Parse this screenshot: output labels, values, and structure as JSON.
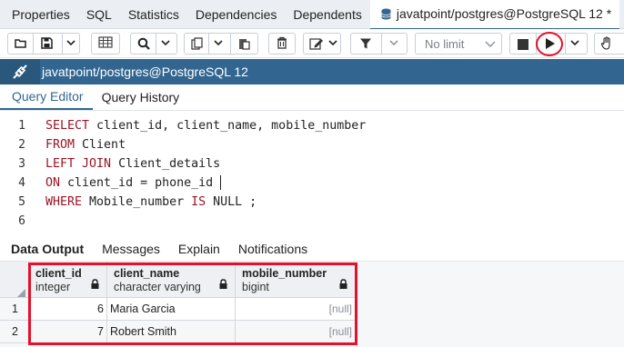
{
  "top_tabs": [
    {
      "label": "Properties"
    },
    {
      "label": "SQL"
    },
    {
      "label": "Statistics"
    },
    {
      "label": "Dependencies"
    },
    {
      "label": "Dependents"
    },
    {
      "label": "javatpoint/postgres@PostgreSQL 12 *",
      "icon": "database-icon",
      "active": true
    }
  ],
  "toolbar": {
    "limit_label": "No limit"
  },
  "connection": {
    "label": "javatpoint/postgres@PostgreSQL 12"
  },
  "editor_tabs": [
    {
      "label": "Query Editor",
      "active": true
    },
    {
      "label": "Query History"
    }
  ],
  "editor": {
    "line_numbers": [
      "1",
      "2",
      "3",
      "4",
      "5",
      "6"
    ],
    "lines": [
      {
        "kw1": "SELECT",
        "rest": " client_id, client_name, mobile_number"
      },
      {
        "kw1": "FROM",
        "rest": " Client"
      },
      {
        "kw1": "LEFT JOIN",
        "rest": " Client_details"
      },
      {
        "kw1": "ON",
        "rest": " client_id = phone_id"
      },
      {
        "kw1": "WHERE",
        "rest": " Mobile_number ",
        "kw2": "IS",
        "rest2": " NULL ;"
      },
      {
        "kw1": "",
        "rest": ""
      }
    ]
  },
  "output_tabs": [
    {
      "label": "Data Output",
      "active": true
    },
    {
      "label": "Messages"
    },
    {
      "label": "Explain"
    },
    {
      "label": "Notifications"
    }
  ],
  "grid": {
    "columns": [
      {
        "name": "client_id",
        "type": "integer"
      },
      {
        "name": "client_name",
        "type": "character varying"
      },
      {
        "name": "mobile_number",
        "type": "bigint"
      }
    ],
    "rows": [
      {
        "num": "1",
        "client_id": "6",
        "client_name": "Maria Garcia",
        "mobile_number": "[null]"
      },
      {
        "num": "2",
        "client_id": "7",
        "client_name": "Robert Smith",
        "mobile_number": "[null]"
      }
    ]
  },
  "colors": {
    "accent": "#326690",
    "keyword": "#9b1424",
    "highlight": "#e5102a"
  }
}
